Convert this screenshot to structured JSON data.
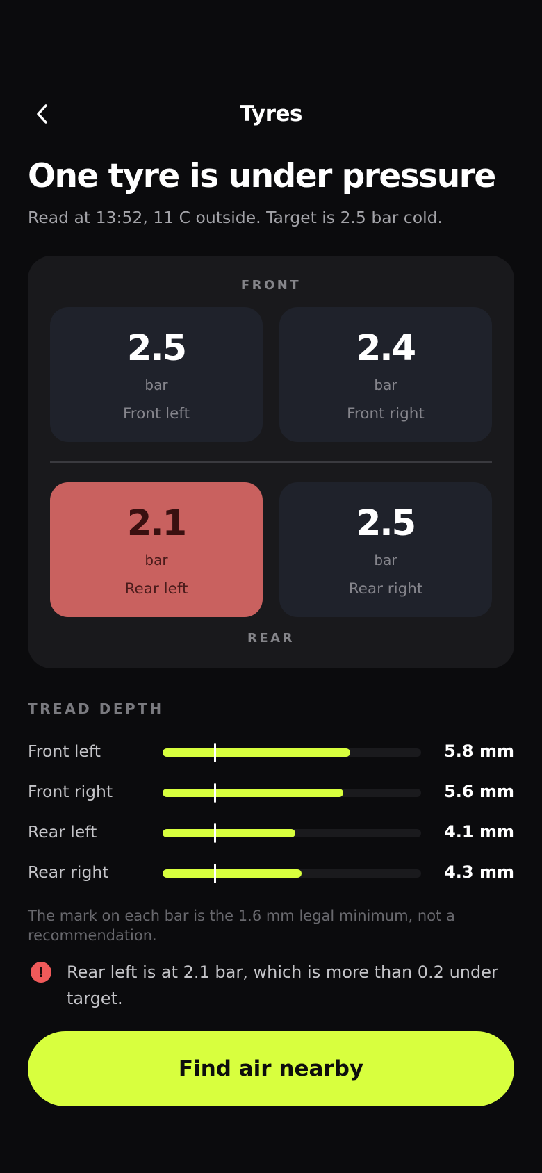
{
  "colors": {
    "background": "#0b0b0d",
    "panel": "#19191c",
    "tyre_card": "#1f222b",
    "tyre_warning": "#c9615f",
    "accent": "#d8ff3e",
    "alert_red": "#f05a5a"
  },
  "nav": {
    "back_icon": "chevron-left-icon",
    "title": "Tyres"
  },
  "header": {
    "headline": "One tyre is under pressure",
    "subline": "Read at 13:52, 11 C outside. Target is 2.5 bar cold."
  },
  "pressure": {
    "front_label": "FRONT",
    "rear_label": "REAR",
    "tyres": [
      {
        "name": "Front left",
        "value": "2.5",
        "unit": "bar",
        "warning": false
      },
      {
        "name": "Front right",
        "value": "2.4",
        "unit": "bar",
        "warning": false
      },
      {
        "name": "Rear left",
        "value": "2.1",
        "unit": "bar",
        "warning": true
      },
      {
        "name": "Rear right",
        "value": "2.5",
        "unit": "bar",
        "warning": false
      }
    ]
  },
  "tread": {
    "title": "TREAD DEPTH",
    "scale_max_mm": 8,
    "legal_minimum_mm": 1.6,
    "rows": [
      {
        "label": "Front left",
        "value_mm": 5.8,
        "display": "5.8 mm"
      },
      {
        "label": "Front right",
        "value_mm": 5.6,
        "display": "5.6 mm"
      },
      {
        "label": "Rear left",
        "value_mm": 4.1,
        "display": "4.1 mm"
      },
      {
        "label": "Rear right",
        "value_mm": 4.3,
        "display": "4.3 mm"
      }
    ],
    "note": "The mark on each bar is the 1.6 mm legal minimum, not a recommendation."
  },
  "alert": {
    "icon": "exclamation-icon",
    "icon_glyph": "!",
    "text": "Rear left is at 2.1 bar, which is more than 0.2 under target."
  },
  "cta": {
    "label": "Find air nearby"
  }
}
